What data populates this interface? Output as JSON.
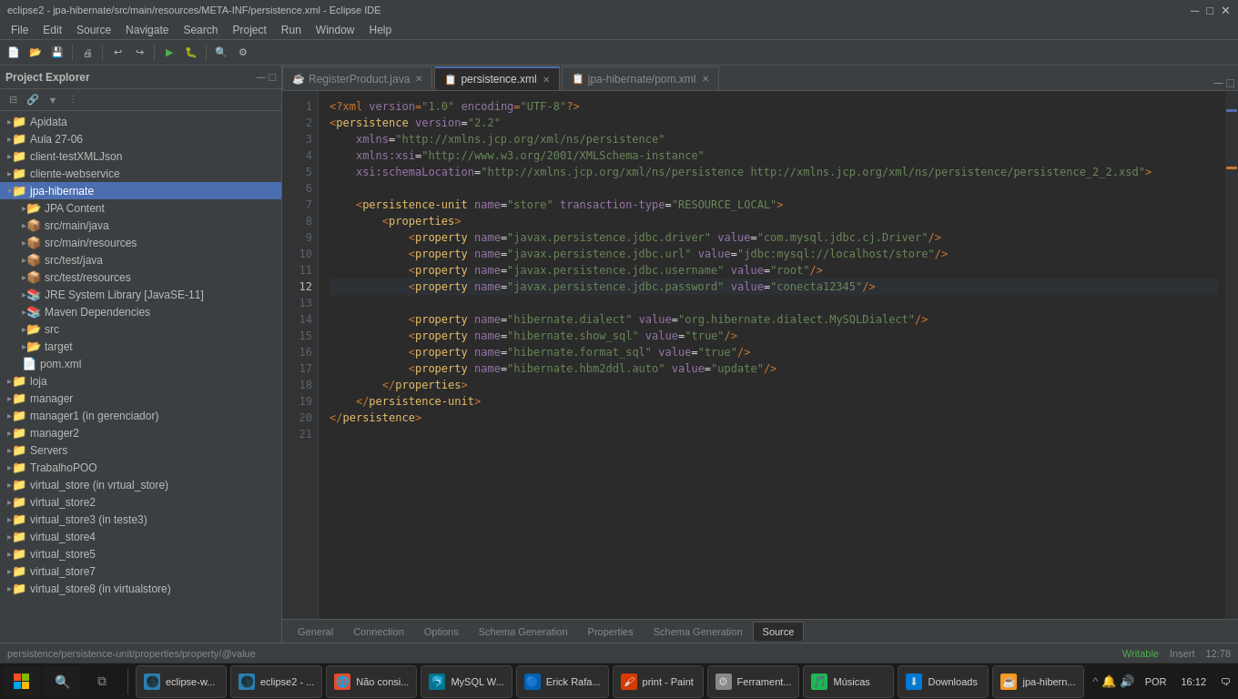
{
  "titleBar": {
    "title": "eclipse2 - jpa-hibernate/src/main/resources/META-INF/persistence.xml - Eclipse IDE",
    "minimize": "─",
    "maximize": "□",
    "close": "✕"
  },
  "menuBar": {
    "items": [
      "File",
      "Edit",
      "Source",
      "Navigate",
      "Search",
      "Project",
      "Run",
      "Window",
      "Help"
    ]
  },
  "tabs": [
    {
      "label": "RegisterProduct.java",
      "active": false,
      "closable": true
    },
    {
      "label": "persistence.xml",
      "active": true,
      "closable": true
    },
    {
      "label": "jpa-hibernate/pom.xml",
      "active": false,
      "closable": true
    }
  ],
  "bottomTabs": [
    "General",
    "Connection",
    "Options",
    "Schema Generation",
    "Properties",
    "Schema Generation",
    "Source"
  ],
  "activeBottomTab": "Source",
  "breadcrumb": "persistence/persistence-unit/properties/property/@value",
  "codeLines": [
    {
      "num": 1,
      "code": "<?xml version=\"1.0\" encoding=\"UTF-8\"?>"
    },
    {
      "num": 2,
      "code": "<persistence version=\"2.2\""
    },
    {
      "num": 3,
      "code": "    xmlns=\"http://xmlns.jcp.org/xml/ns/persistence\""
    },
    {
      "num": 4,
      "code": "    xmlns:xsi=\"http://www.w3.org/2001/XMLSchema-instance\""
    },
    {
      "num": 5,
      "code": "    xsi:schemaLocation=\"http://xmlns.jcp.org/xml/ns/persistence http://xmlns.jcp.org/xml/ns/persistence/persistence_2_2.xsd\">"
    },
    {
      "num": 6,
      "code": ""
    },
    {
      "num": 7,
      "code": "    <persistence-unit name=\"store\" transaction-type=\"RESOURCE_LOCAL\">"
    },
    {
      "num": 8,
      "code": "        <properties>"
    },
    {
      "num": 9,
      "code": "            <property name=\"javax.persistence.jdbc.driver\" value=\"com.mysql.jdbc.cj.Driver\"/>"
    },
    {
      "num": 10,
      "code": "            <property name=\"javax.persistence.jdbc.url\" value=\"jdbc:mysql://localhost/store\"/>"
    },
    {
      "num": 11,
      "code": "            <property name=\"javax.persistence.jdbc.username\" value=\"root\"/>"
    },
    {
      "num": 12,
      "code": "            <property name=\"javax.persistence.jdbc.password\" value=\"conecta12345\"/>",
      "active": true
    },
    {
      "num": 13,
      "code": ""
    },
    {
      "num": 14,
      "code": "            <property name=\"hibernate.dialect\" value=\"org.hibernate.dialect.MySQLDialect\"/>"
    },
    {
      "num": 15,
      "code": "            <property name=\"hibernate.show_sql\" value=\"true\"/>"
    },
    {
      "num": 16,
      "code": "            <property name=\"hibernate.format_sql\" value=\"true\"/>"
    },
    {
      "num": 17,
      "code": "            <property name=\"hibernate.hbm2ddl.auto\" value=\"update\"/>"
    },
    {
      "num": 18,
      "code": "        </properties>"
    },
    {
      "num": 19,
      "code": "    </persistence-unit>"
    },
    {
      "num": 20,
      "code": "</persistence>"
    },
    {
      "num": 21,
      "code": ""
    }
  ],
  "projectExplorer": {
    "title": "Project Explorer",
    "items": [
      {
        "label": "Apidata",
        "indent": 0,
        "type": "folder",
        "expanded": false
      },
      {
        "label": "Aula 27-06",
        "indent": 0,
        "type": "folder",
        "expanded": false
      },
      {
        "label": "client-testXMLJson",
        "indent": 0,
        "type": "folder",
        "expanded": false
      },
      {
        "label": "cliente-webservice",
        "indent": 0,
        "type": "folder",
        "expanded": false
      },
      {
        "label": "jpa-hibernate",
        "indent": 0,
        "type": "folder",
        "expanded": true,
        "selected": true
      },
      {
        "label": "JPA Content",
        "indent": 1,
        "type": "folder",
        "expanded": false
      },
      {
        "label": "src/main/java",
        "indent": 1,
        "type": "pkg",
        "expanded": false
      },
      {
        "label": "src/main/resources",
        "indent": 1,
        "type": "pkg",
        "expanded": false
      },
      {
        "label": "src/test/java",
        "indent": 1,
        "type": "pkg",
        "expanded": false
      },
      {
        "label": "src/test/resources",
        "indent": 1,
        "type": "pkg",
        "expanded": false
      },
      {
        "label": "JRE System Library [JavaSE-11]",
        "indent": 1,
        "type": "lib",
        "expanded": false
      },
      {
        "label": "Maven Dependencies",
        "indent": 1,
        "type": "lib",
        "expanded": false
      },
      {
        "label": "src",
        "indent": 1,
        "type": "folder",
        "expanded": false
      },
      {
        "label": "target",
        "indent": 1,
        "type": "folder",
        "expanded": false
      },
      {
        "label": "pom.xml",
        "indent": 1,
        "type": "file"
      },
      {
        "label": "loja",
        "indent": 0,
        "type": "folder",
        "expanded": false
      },
      {
        "label": "manager",
        "indent": 0,
        "type": "folder",
        "expanded": false
      },
      {
        "label": "manager1 (in gerenciador)",
        "indent": 0,
        "type": "folder",
        "expanded": false
      },
      {
        "label": "manager2",
        "indent": 0,
        "type": "folder",
        "expanded": false
      },
      {
        "label": "Servers",
        "indent": 0,
        "type": "folder",
        "expanded": false
      },
      {
        "label": "TrabalhoPOO",
        "indent": 0,
        "type": "folder",
        "expanded": false
      },
      {
        "label": "virtual_store (in vrtual_store)",
        "indent": 0,
        "type": "folder",
        "expanded": false
      },
      {
        "label": "virtual_store2",
        "indent": 0,
        "type": "folder",
        "expanded": false
      },
      {
        "label": "virtual_store3 (in teste3)",
        "indent": 0,
        "type": "folder",
        "expanded": false
      },
      {
        "label": "virtual_store4",
        "indent": 0,
        "type": "folder",
        "expanded": false
      },
      {
        "label": "virtual_store5",
        "indent": 0,
        "type": "folder",
        "expanded": false
      },
      {
        "label": "virtual_store7",
        "indent": 0,
        "type": "folder",
        "expanded": false
      },
      {
        "label": "virtual_store8 (in virtualstore)",
        "indent": 0,
        "type": "folder",
        "expanded": false
      }
    ]
  },
  "statusBar": {
    "left": "persistence/persistence-unit/properties/property/@value",
    "right": ""
  },
  "taskbar": {
    "apps": [
      {
        "label": "eclipse-w...",
        "icon": "🌑",
        "color": "#2c7eaf"
      },
      {
        "label": "eclipse2 - ...",
        "icon": "🌑",
        "color": "#2c7eaf"
      },
      {
        "label": "Não consi...",
        "icon": "🌐",
        "color": "#e44c2c"
      },
      {
        "label": "MySQL W...",
        "icon": "🐬",
        "color": "#00758f"
      },
      {
        "label": "Erick Rafa...",
        "icon": "🔵",
        "color": "#0063b1"
      },
      {
        "label": "print - Paint",
        "icon": "🖌",
        "color": "#d83b01"
      },
      {
        "label": "Ferrament...",
        "icon": "⚙",
        "color": "#888"
      },
      {
        "label": "Músicas",
        "icon": "🎵",
        "color": "#1db954"
      },
      {
        "label": "Downloads",
        "icon": "⬇",
        "color": "#0078d4"
      },
      {
        "label": "jpa-hibern...",
        "icon": "☕",
        "color": "#f89820"
      }
    ],
    "time": "16:12",
    "lang": "POR",
    "date": ""
  }
}
